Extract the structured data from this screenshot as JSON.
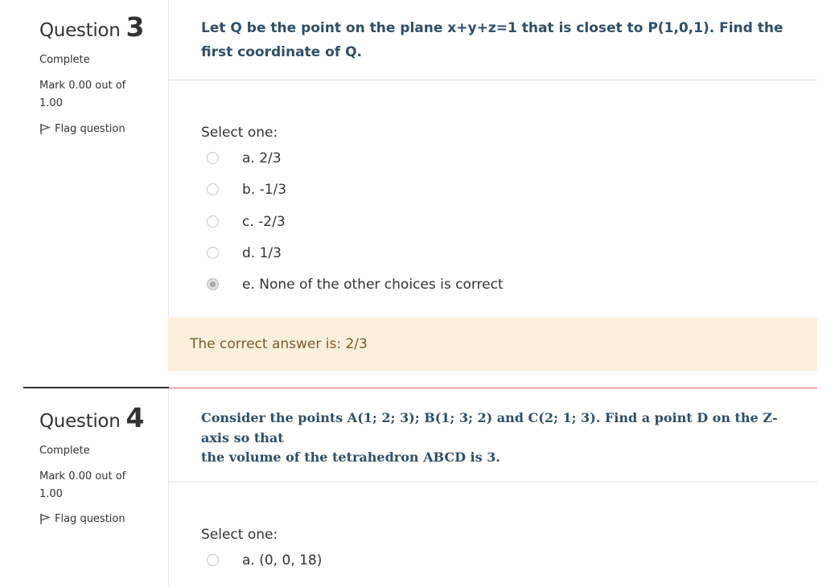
{
  "q3": {
    "label": "Question",
    "number": "3",
    "state": "Complete",
    "grade": "Mark 0.00 out of 1.00",
    "flag_label": "Flag question",
    "text": "Let Q be the point on the plane x+y+z=1 that is closet to P(1,0,1). Find the first coordinate of Q.",
    "prompt": "Select one:",
    "options": [
      {
        "label": "a. 2/3",
        "checked": false
      },
      {
        "label": "b. -1/3",
        "checked": false
      },
      {
        "label": "c. -2/3",
        "checked": false
      },
      {
        "label": "d. 1/3",
        "checked": false
      },
      {
        "label": "e. None of the other choices is correct",
        "checked": true
      }
    ],
    "feedback": "The correct answer is: 2/3"
  },
  "q4": {
    "label": "Question",
    "number": "4",
    "state": "Complete",
    "grade": "Mark 0.00 out of 1.00",
    "flag_label": "Flag question",
    "text_line1": "Consider the points A(1; 2; 3); B(1; 3; 2) and C(2; 1; 3). Find a point D on the Z-axis so that",
    "text_line2": "the volume of the tetrahedron ABCD is 3.",
    "prompt": "Select one:",
    "options": [
      {
        "label": "a. (0, 0, 18)",
        "checked": false
      }
    ]
  },
  "colors": {
    "question_text": "#2f4f68",
    "feedback_bg": "#fcefdc",
    "feedback_text": "#7d5a29",
    "divider_red": "#e06070"
  },
  "icons": {
    "flag": "flag-icon"
  }
}
